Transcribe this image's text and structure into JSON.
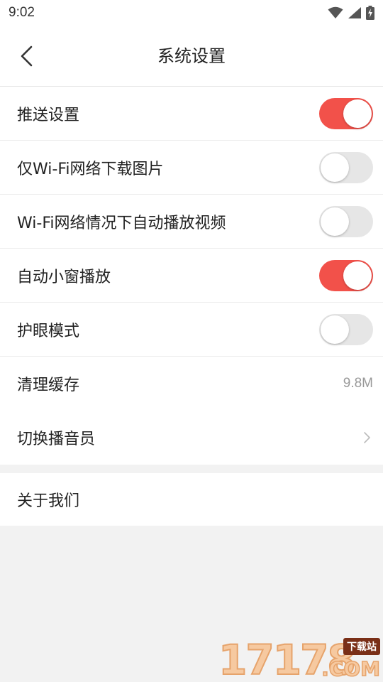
{
  "status_bar": {
    "time": "9:02",
    "icons": [
      "wifi-icon",
      "cellular-signal-icon",
      "battery-charging-icon"
    ]
  },
  "header": {
    "title": "系统设置",
    "back_icon": "chevron-left-icon"
  },
  "colors": {
    "accent": "#f2514a",
    "toggle_off": "#e6e6e6",
    "background": "#f2f2f2"
  },
  "settings": [
    {
      "label": "推送设置",
      "type": "toggle",
      "on": true
    },
    {
      "label": "仅Wi-Fi网络下载图片",
      "type": "toggle",
      "on": false
    },
    {
      "label": "Wi-Fi网络情况下自动播放视频",
      "type": "toggle",
      "on": false
    },
    {
      "label": "自动小窗播放",
      "type": "toggle",
      "on": true
    },
    {
      "label": "护眼模式",
      "type": "toggle",
      "on": false
    },
    {
      "label": "清理缓存",
      "type": "value",
      "value": "9.8M"
    },
    {
      "label": "切换播音员",
      "type": "link",
      "icon": "chevron-right-icon"
    }
  ],
  "about": {
    "label": "关于我们"
  },
  "watermark": {
    "number": "17178",
    "badge": "下载站",
    "suffix": ".COM"
  }
}
